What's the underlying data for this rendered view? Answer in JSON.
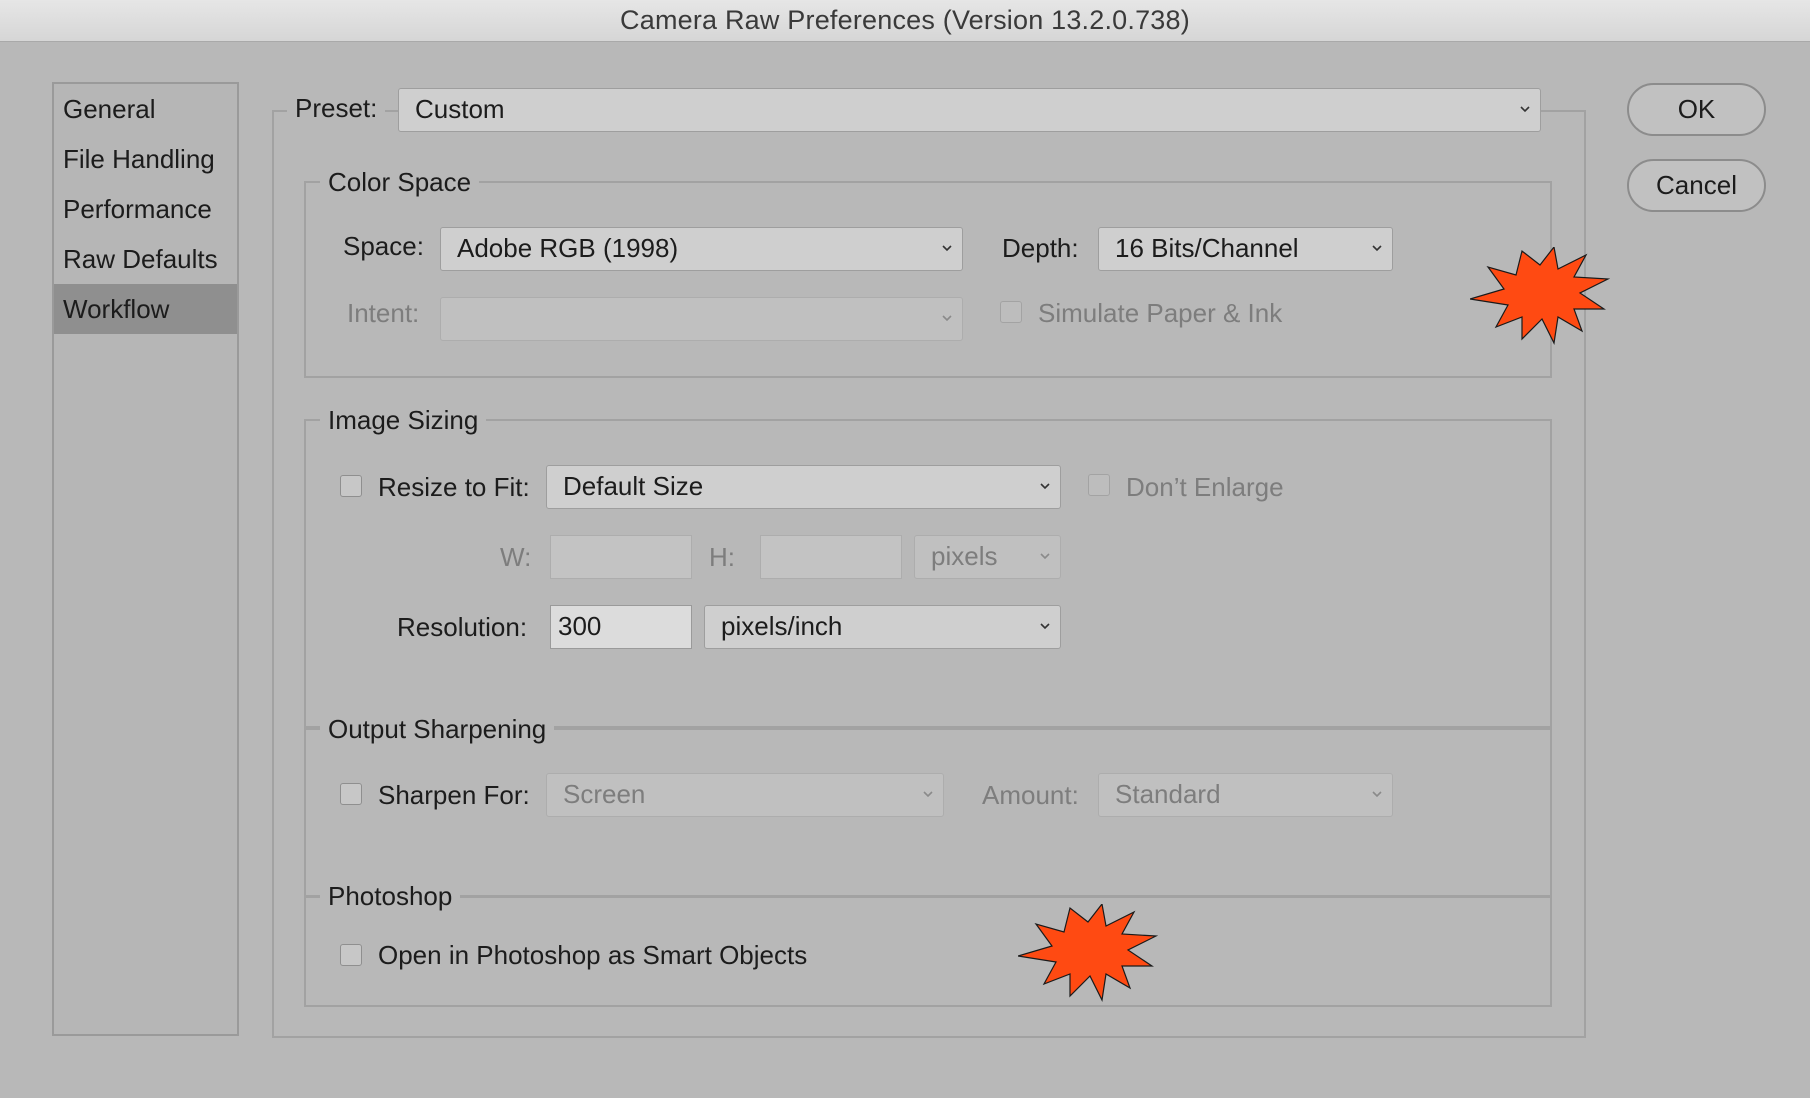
{
  "window": {
    "title": "Camera Raw Preferences  (Version 13.2.0.738)"
  },
  "sidebar": {
    "items": [
      {
        "label": "General"
      },
      {
        "label": "File Handling"
      },
      {
        "label": "Performance"
      },
      {
        "label": "Raw Defaults"
      },
      {
        "label": "Workflow",
        "selected": true
      }
    ]
  },
  "preset": {
    "label": "Preset:",
    "value": "Custom"
  },
  "buttons": {
    "ok": "OK",
    "cancel": "Cancel"
  },
  "color_space": {
    "title": "Color Space",
    "space_label": "Space:",
    "space_value": "Adobe RGB (1998)",
    "depth_label": "Depth:",
    "depth_value": "16 Bits/Channel",
    "intent_label": "Intent:",
    "intent_value": "",
    "simulate_label": "Simulate Paper & Ink",
    "simulate_checked": false
  },
  "image_sizing": {
    "title": "Image Sizing",
    "resize_label": "Resize to Fit:",
    "resize_checked": false,
    "resize_value": "Default Size",
    "dont_enlarge_label": "Don’t Enlarge",
    "dont_enlarge_checked": false,
    "w_label": "W:",
    "w_value": "",
    "h_label": "H:",
    "h_value": "",
    "unit_value": "pixels",
    "resolution_label": "Resolution:",
    "resolution_value": "300",
    "resolution_unit": "pixels/inch"
  },
  "output_sharpening": {
    "title": "Output Sharpening",
    "sharpen_label": "Sharpen For:",
    "sharpen_checked": false,
    "sharpen_value": "Screen",
    "amount_label": "Amount:",
    "amount_value": "Standard"
  },
  "photoshop": {
    "title": "Photoshop",
    "smart_objects_label": "Open in Photoshop as Smart Objects",
    "smart_objects_checked": false
  },
  "annotations": {
    "burst_color": "#ff4a12"
  }
}
